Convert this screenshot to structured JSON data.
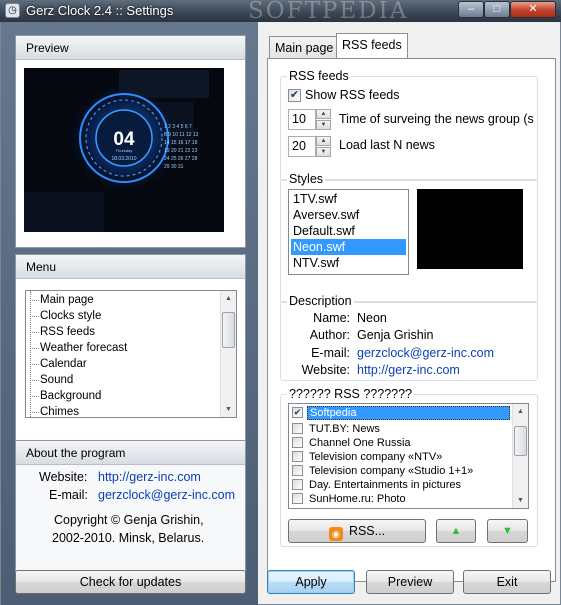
{
  "window": {
    "title": "Gerz Clock 2.4 :: Settings",
    "watermark": "SOFTPEDIA",
    "min_glyph": "–",
    "max_glyph": "□",
    "close_glyph": "✕"
  },
  "sidebar": {
    "preview_title": "Preview",
    "preview_clock": {
      "time": "04",
      "day": "Thursday",
      "date": "18.03.2010"
    },
    "menu_title": "Menu",
    "menu_items": [
      "Main page",
      "Clocks style",
      "RSS feeds",
      "Weather forecast",
      "Calendar",
      "Sound",
      "Background",
      "Chimes"
    ],
    "about_title": "About the program",
    "website_label": "Website:",
    "website_value": "http://gerz-inc.com",
    "email_label": "E-mail:",
    "email_value": "gerzclock@gerz-inc.com",
    "copyright_line1": "Copyright © Genja Grishin,",
    "copyright_line2": "2002-2010. Minsk, Belarus.",
    "check_updates_label": "Check for updates"
  },
  "tabs": [
    {
      "label": "Main page",
      "active": false
    },
    {
      "label": "RSS feeds",
      "active": true
    }
  ],
  "rss": {
    "legend": "RSS feeds",
    "show_label": "Show RSS feeds",
    "show_checked": true,
    "time_value": "10",
    "time_label": "Time of surveing the news group (s",
    "load_value": "20",
    "load_label": "Load last N news"
  },
  "styles": {
    "legend": "Styles",
    "items": [
      "1TV.swf",
      "Aversev.swf",
      "Default.swf",
      "Neon.swf",
      "NTV.swf"
    ],
    "selected_index": 3
  },
  "description": {
    "legend": "Description",
    "name_label": "Name:",
    "name_value": "Neon",
    "author_label": "Author:",
    "author_value": "Genja Grishin",
    "email_label": "E-mail:",
    "email_value": "gerzclock@gerz-inc.com",
    "website_label": "Website:",
    "website_value": "http://gerz-inc.com"
  },
  "feeds": {
    "legend": "?????? RSS ???????",
    "items": [
      {
        "label": "Softpedia",
        "checked": true,
        "selected": true
      },
      {
        "label": "TUT.BY: News",
        "checked": false,
        "selected": false
      },
      {
        "label": "Channel One Russia",
        "checked": false,
        "selected": false
      },
      {
        "label": "Television company «NTV»",
        "checked": false,
        "selected": false
      },
      {
        "label": "Television company «Studio 1+1»",
        "checked": false,
        "selected": false
      },
      {
        "label": "Day. Entertainments in pictures",
        "checked": false,
        "selected": false
      },
      {
        "label": "SunHome.ru: Photo",
        "checked": false,
        "selected": false
      }
    ],
    "rss_button_label": "RSS...",
    "up_glyph": "▲",
    "down_glyph": "▼"
  },
  "footer": {
    "apply_label": "Apply",
    "preview_label": "Preview",
    "exit_label": "Exit"
  },
  "colors": {
    "accent_blue": "#3399ff",
    "rss_orange": "#f28a1a",
    "arrow_green": "#2fbf3a"
  }
}
